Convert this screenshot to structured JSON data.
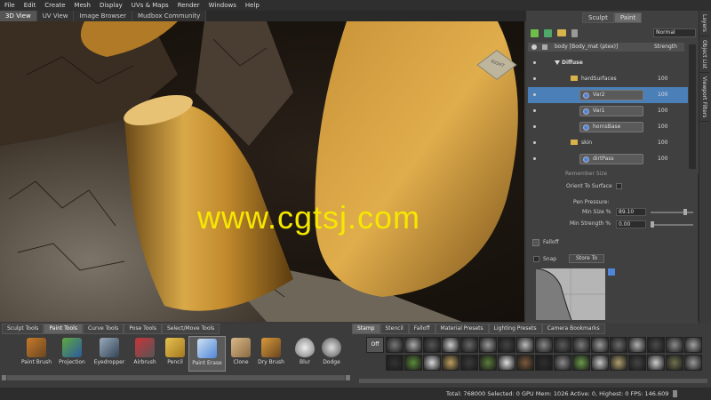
{
  "menu": [
    "File",
    "Edit",
    "Create",
    "Mesh",
    "Display",
    "UVs & Maps",
    "Render",
    "Windows",
    "Help"
  ],
  "view_tabs": [
    "3D View",
    "UV View",
    "Image Browser",
    "Mudbox Community"
  ],
  "viewport": {
    "watermark": "www.cgtsj.com",
    "navcube_label": "RIGHT"
  },
  "right_panel": {
    "mode_tabs": [
      "Sculpt",
      "Paint"
    ],
    "blend_mode": "Normal",
    "layer_header": {
      "name": "body [Body_mat (ptex)]",
      "strength": "Strength"
    },
    "layers": [
      {
        "label": "Diffuse",
        "strength": ""
      },
      {
        "label": "hardSurfaces",
        "strength": "100"
      },
      {
        "label": "Var2",
        "strength": "100"
      },
      {
        "label": "Var1",
        "strength": "100"
      },
      {
        "label": "hornsBase",
        "strength": "100"
      },
      {
        "label": "skin",
        "strength": "100"
      },
      {
        "label": "dirtPass",
        "strength": "100"
      }
    ],
    "properties": {
      "remember_size": "Remember Size",
      "orient_to_surface": "Orient To Surface",
      "pen_pressure": "Pen Pressure:",
      "min_size_label": "Min Size %",
      "min_size_value": "89.10",
      "min_strength_label": "Min Strength %",
      "min_strength_value": "0.00",
      "falloff": "Falloff",
      "snap": "Snap",
      "store_to": "Store To"
    }
  },
  "side_tabs": [
    "Layers",
    "Object List",
    "Viewport Filters"
  ],
  "tool_tray": {
    "tabs": [
      "Sculpt Tools",
      "Paint Tools",
      "Curve Tools",
      "Pose Tools",
      "Select/Move Tools"
    ],
    "tools": [
      "Paint Brush",
      "Projection",
      "Eyedropper",
      "Airbrush",
      "Pencil",
      "Paint Erase",
      "Clone",
      "Dry Brush",
      "Blur",
      "Dodge"
    ]
  },
  "stamp_tray": {
    "tabs": [
      "Stamp",
      "Stencil",
      "Falloff",
      "Material Presets",
      "Lighting Presets",
      "Camera Bookmarks"
    ],
    "off_label": "Off"
  },
  "status": "Total: 768000  Selected: 0  GPU Mem: 1026  Active: 0, Highest: 0  FPS: 146.609"
}
